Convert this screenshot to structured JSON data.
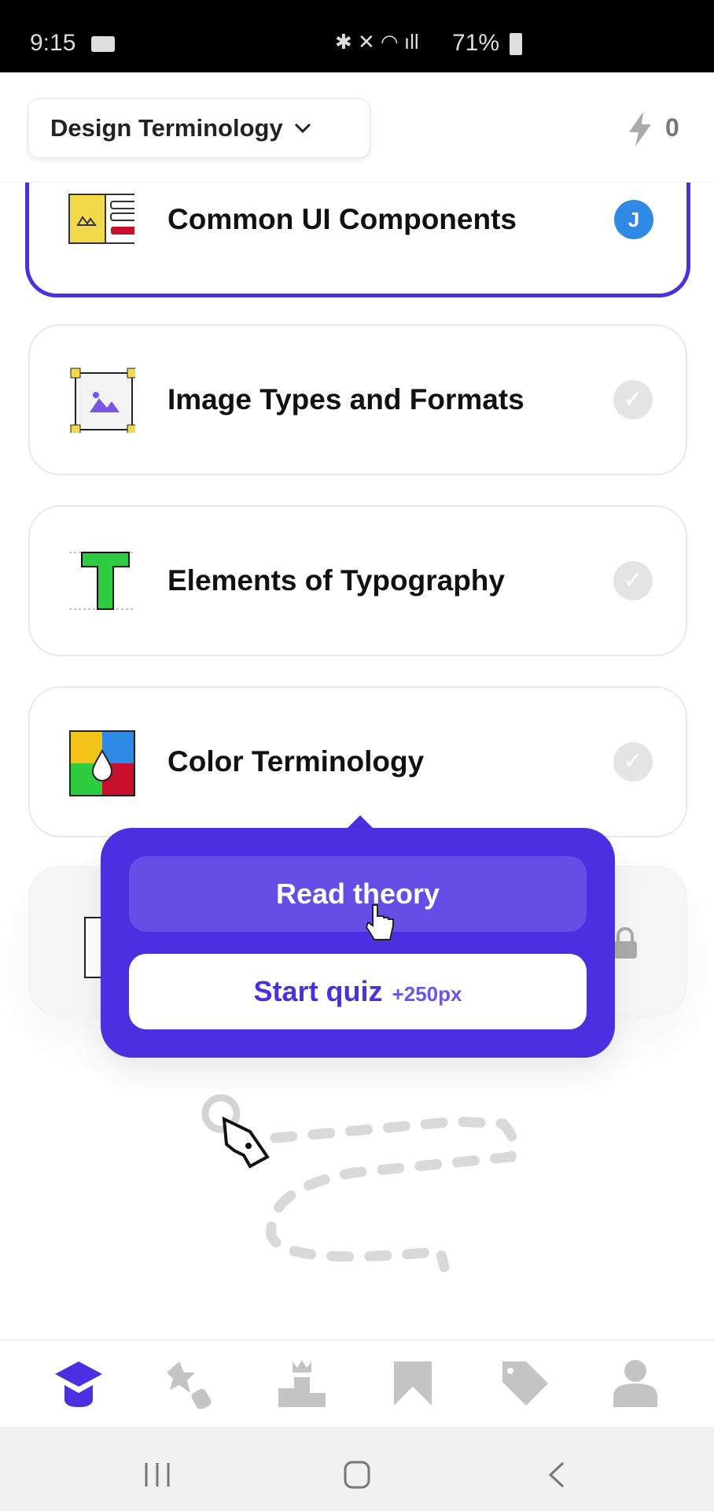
{
  "status_bar": {
    "time": "9:15",
    "battery": "71%"
  },
  "header": {
    "course": "Design Terminology",
    "energy": "0"
  },
  "lessons": [
    {
      "title": "Common UI Components",
      "state": "current",
      "badge": "J"
    },
    {
      "title": "Image Types and Formats",
      "state": "completed"
    },
    {
      "title": "Elements of Typography",
      "state": "completed"
    },
    {
      "title": "Color Terminology",
      "state": "completed"
    },
    {
      "title": "",
      "state": "locked"
    }
  ],
  "popup": {
    "read_label": "Read theory",
    "quiz_label": "Start quiz",
    "quiz_reward": "+250px"
  },
  "bottom_nav": [
    "learn-icon",
    "achievements-icon",
    "leaderboard-icon",
    "bookmarks-icon",
    "shop-tag-icon",
    "profile-icon"
  ],
  "colors": {
    "accent": "#4b2fe0",
    "inactive": "#c4c4c4",
    "badge": "#2f8ae6"
  }
}
